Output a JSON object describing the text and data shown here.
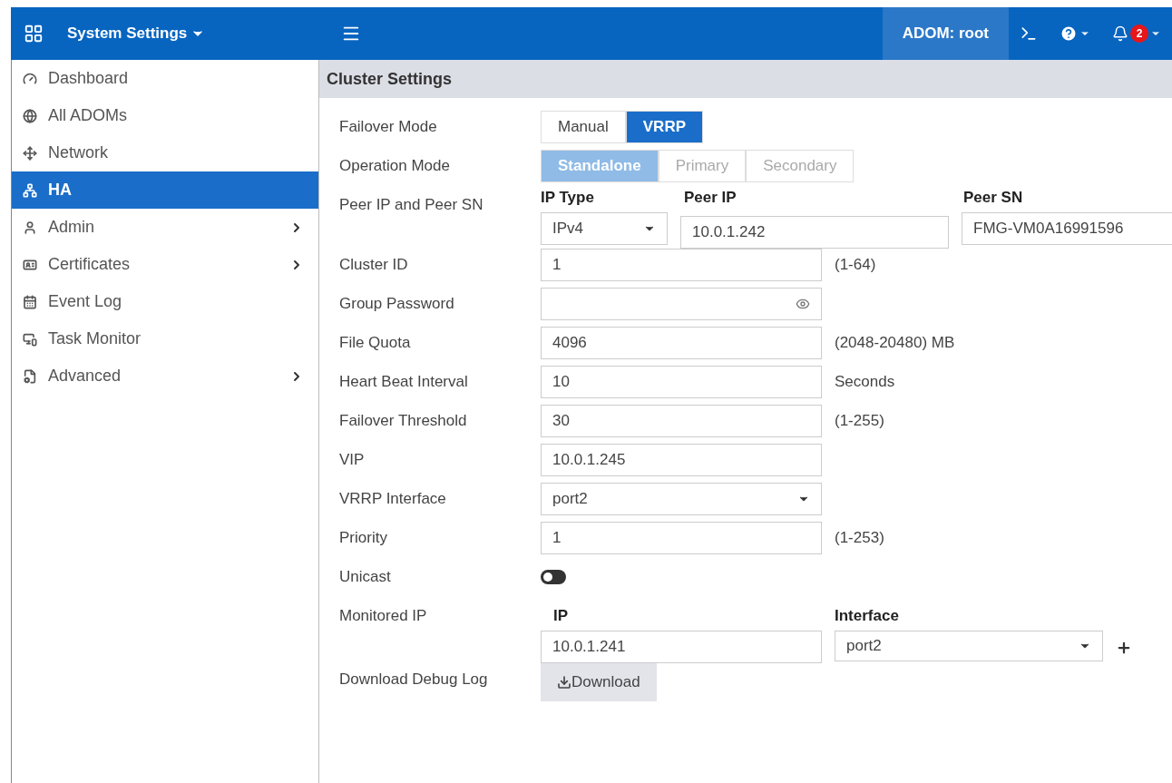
{
  "header": {
    "app_menu": "System Settings",
    "adom": "ADOM: root",
    "notification_count": "2"
  },
  "sidebar": {
    "items": [
      {
        "label": "Dashboard",
        "selected": false,
        "submenu": false
      },
      {
        "label": "All ADOMs",
        "selected": false,
        "submenu": false
      },
      {
        "label": "Network",
        "selected": false,
        "submenu": false
      },
      {
        "label": "HA",
        "selected": true,
        "submenu": false
      },
      {
        "label": "Admin",
        "selected": false,
        "submenu": true
      },
      {
        "label": "Certificates",
        "selected": false,
        "submenu": true
      },
      {
        "label": "Event Log",
        "selected": false,
        "submenu": false
      },
      {
        "label": "Task Monitor",
        "selected": false,
        "submenu": false
      },
      {
        "label": "Advanced",
        "selected": false,
        "submenu": true
      }
    ]
  },
  "panel": {
    "title": "Cluster Settings",
    "rows": [
      {
        "kind": "segmented",
        "label": "Failover Mode",
        "disabled": false,
        "options": [
          {
            "label": "Manual",
            "selected": false
          },
          {
            "label": "VRRP",
            "selected": true
          }
        ]
      },
      {
        "kind": "segmented",
        "label": "Operation Mode",
        "disabled": true,
        "options": [
          {
            "label": "Standalone",
            "selected": true
          },
          {
            "label": "Primary",
            "selected": false
          },
          {
            "label": "Secondary",
            "selected": false
          }
        ]
      },
      {
        "kind": "peer",
        "label": "Peer IP and Peer SN",
        "headings": [
          "IP Type",
          "Peer IP",
          "Peer SN"
        ],
        "ip_type": "IPv4",
        "peer_ip": "10.0.1.242",
        "peer_sn": "FMG-VM0A16991596"
      },
      {
        "kind": "input",
        "label": "Cluster ID",
        "value": "1",
        "hint": "(1-64)"
      },
      {
        "kind": "password",
        "label": "Group Password"
      },
      {
        "kind": "input",
        "label": "File Quota",
        "value": "4096",
        "hint": "(2048-20480) MB"
      },
      {
        "kind": "input",
        "label": "Heart Beat Interval",
        "value": "10",
        "hint": "Seconds"
      },
      {
        "kind": "input",
        "label": "Failover Threshold",
        "value": "30",
        "hint": "(1-255)"
      },
      {
        "kind": "input",
        "label": "VIP",
        "value": "10.0.1.245"
      },
      {
        "kind": "select",
        "label": "VRRP Interface",
        "value": "port2"
      },
      {
        "kind": "input",
        "label": "Priority",
        "value": "1",
        "hint": "(1-253)"
      },
      {
        "kind": "toggle",
        "label": "Unicast",
        "on": false
      },
      {
        "kind": "monitored",
        "label": "Monitored IP",
        "headings": [
          "IP",
          "Interface"
        ],
        "ip": "10.0.1.241",
        "interface": "port2"
      },
      {
        "kind": "button",
        "label": "Download Debug Log",
        "button": "Download"
      }
    ]
  }
}
